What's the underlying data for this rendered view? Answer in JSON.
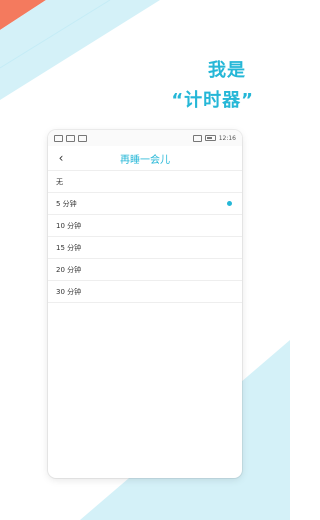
{
  "headline": {
    "line1": "我是",
    "line2": "“计时器”"
  },
  "colors": {
    "accent": "#25b7d7",
    "stripe_light": "#d4f1f8",
    "coral": "#f47a5e"
  },
  "statusbar": {
    "time": "12:16"
  },
  "nav": {
    "title": "再睡一会儿",
    "back_icon": "chevron-left-icon"
  },
  "options": [
    {
      "label": "无",
      "selected": false
    },
    {
      "label": "5 分钟",
      "selected": true
    },
    {
      "label": "10 分钟",
      "selected": false
    },
    {
      "label": "15 分钟",
      "selected": false
    },
    {
      "label": "20 分钟",
      "selected": false
    },
    {
      "label": "30 分钟",
      "selected": false
    }
  ]
}
